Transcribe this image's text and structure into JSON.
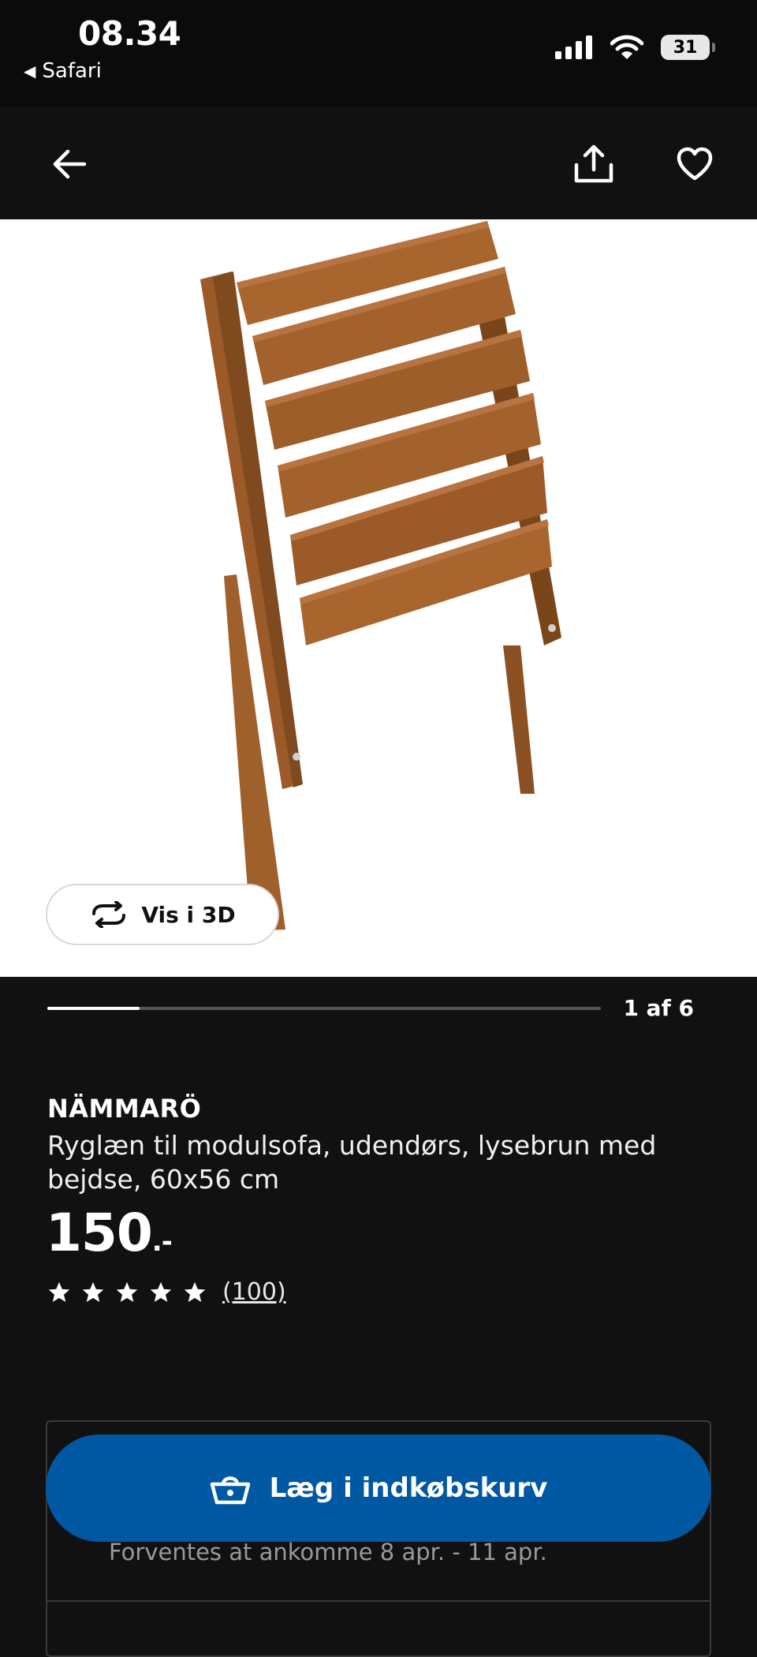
{
  "status_bar": {
    "time": "08.34",
    "back_app": "Safari",
    "battery": "31"
  },
  "nav": {
    "back": "back-arrow-icon",
    "share": "share-icon",
    "favorite": "heart-icon"
  },
  "image": {
    "view_3d_label": "Vis i 3D"
  },
  "gallery": {
    "position": "1 af 6",
    "progress": 0.167
  },
  "product": {
    "name": "NÄMMARÖ",
    "description": "Ryglæn til modulsofa, udendørs, lysebrun med bejdse, 60x56 cm",
    "price": "150",
    "price_suffix": ".-",
    "rating": 5,
    "reviews": "(100)"
  },
  "actions": {
    "add_to_cart": "Læg i indkøbskurv",
    "arrival": "Forventes at ankomme 8 apr. - 11 apr."
  },
  "colors": {
    "accent": "#0058a3",
    "background": "#111111",
    "wood": "#9b5a28"
  }
}
